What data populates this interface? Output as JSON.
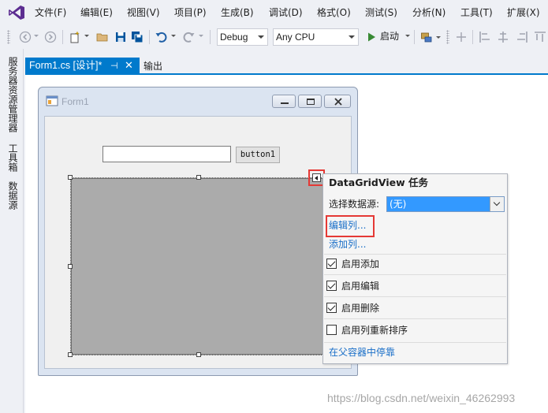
{
  "menu": {
    "items": [
      "文件(F)",
      "编辑(E)",
      "视图(V)",
      "项目(P)",
      "生成(B)",
      "调试(D)",
      "格式(O)",
      "测试(S)",
      "分析(N)",
      "工具(T)",
      "扩展(X)"
    ]
  },
  "toolbar": {
    "config_value": "Debug",
    "platform_value": "Any CPU",
    "start_label": "启动"
  },
  "side_strip": {
    "tabs": [
      "服务器资源管理器",
      "工具箱",
      "数据源"
    ]
  },
  "doc_tabs": {
    "active_label": "Form1.cs [设计]*",
    "pin_glyph": "⊣",
    "close_glyph": "✕",
    "output_label": "输出"
  },
  "form": {
    "title": "Form1",
    "button1_label": "button1"
  },
  "smart_tag_panel": {
    "title": "DataGridView 任务",
    "datasource_label": "选择数据源:",
    "datasource_value": "(无)",
    "edit_columns": "编辑列...",
    "add_column": "添加列...",
    "checks": [
      {
        "label": "启用添加",
        "checked": true
      },
      {
        "label": "启用编辑",
        "checked": true
      },
      {
        "label": "启用删除",
        "checked": true
      },
      {
        "label": "启用列重新排序",
        "checked": false
      }
    ],
    "dock_link": "在父容器中停靠"
  },
  "watermark": "https://blog.csdn.net/weixin_46262993",
  "colors": {
    "accent": "#007acc",
    "highlight_box": "#e53935",
    "grid_fill": "#ababab",
    "combo_selected": "#3399ff",
    "link": "#1a6fc8"
  }
}
